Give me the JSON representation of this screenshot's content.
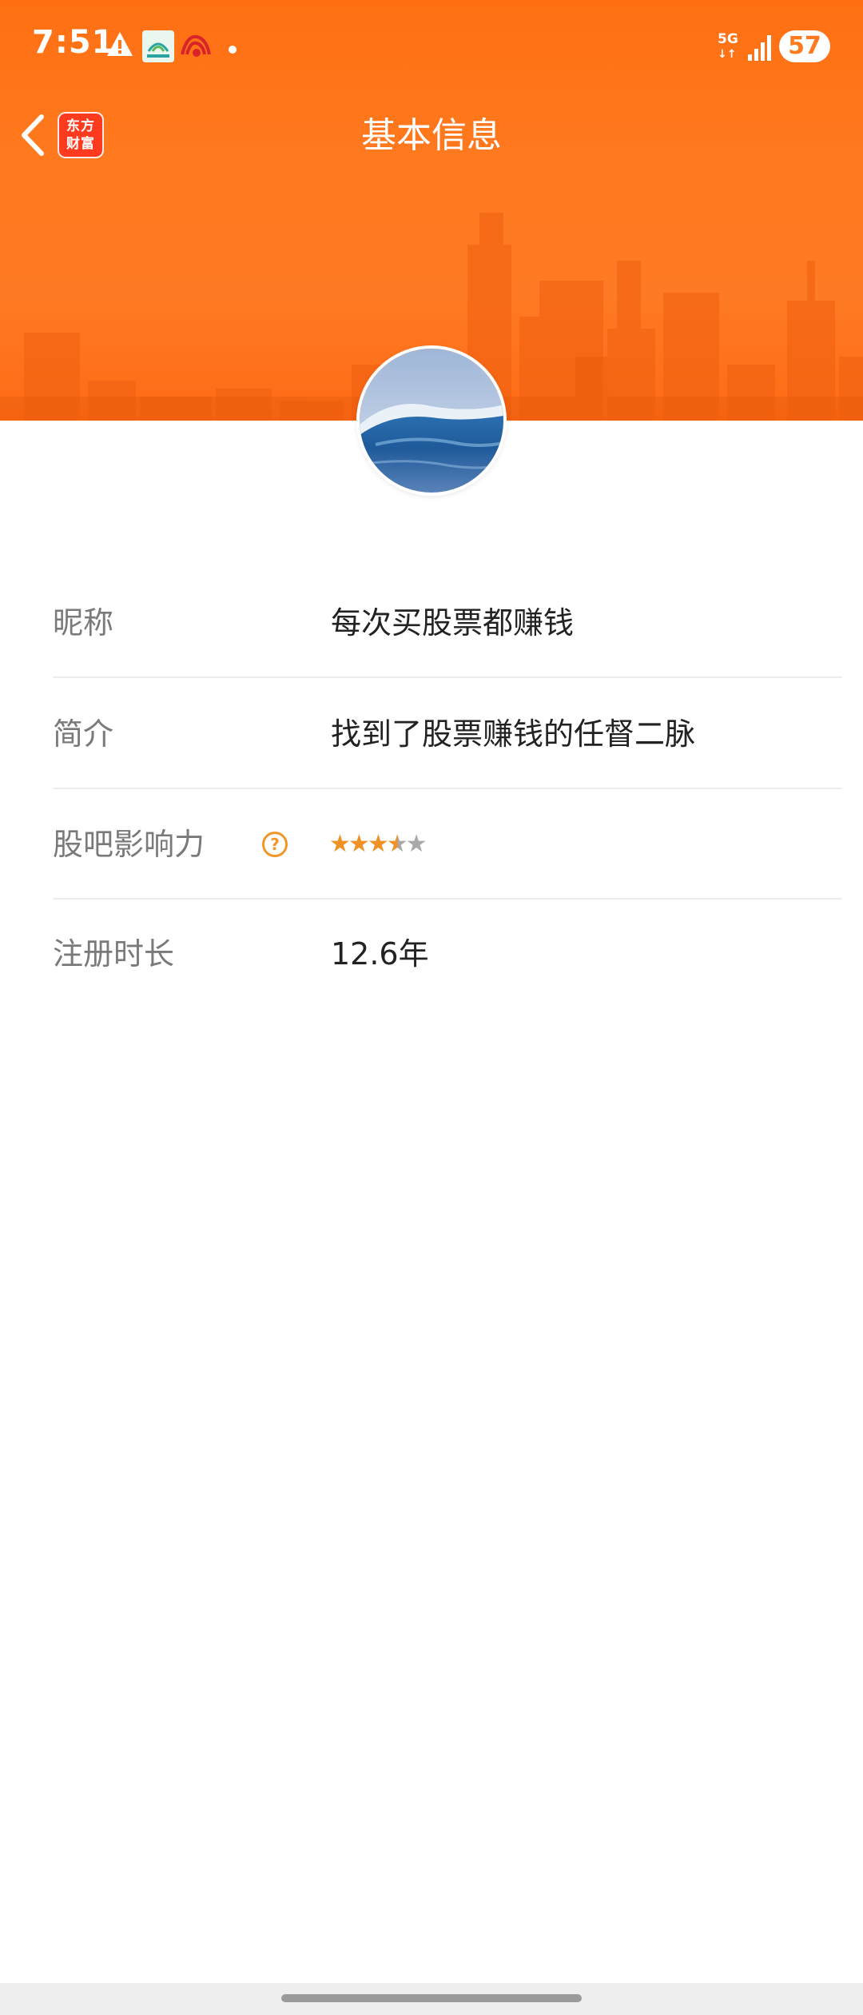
{
  "status_bar": {
    "time": "7:51",
    "network": "5G",
    "battery": "57",
    "icons": [
      "warning-icon",
      "app-notification-icon",
      "app-notification-icon",
      "dot-icon",
      "signal-icon"
    ]
  },
  "header": {
    "title": "基本信息",
    "back_icon": "chevron-left-icon",
    "logo_line1": "东方",
    "logo_line2": "财富",
    "accent_color": "#ff7a1f"
  },
  "profile": {
    "avatar": "ocean-wave-image",
    "rows": [
      {
        "label": "昵称",
        "value": "每次买股票都赚钱"
      },
      {
        "label": "简介",
        "value": "找到了股票赚钱的任督二脉"
      },
      {
        "label": "股吧影响力",
        "help_icon": "question-circle-icon",
        "rating": 3.5,
        "rating_max": 5
      },
      {
        "label": "注册时长",
        "value": "12.6年"
      }
    ]
  },
  "help_glyph": "?",
  "star_color": "#ef9225"
}
